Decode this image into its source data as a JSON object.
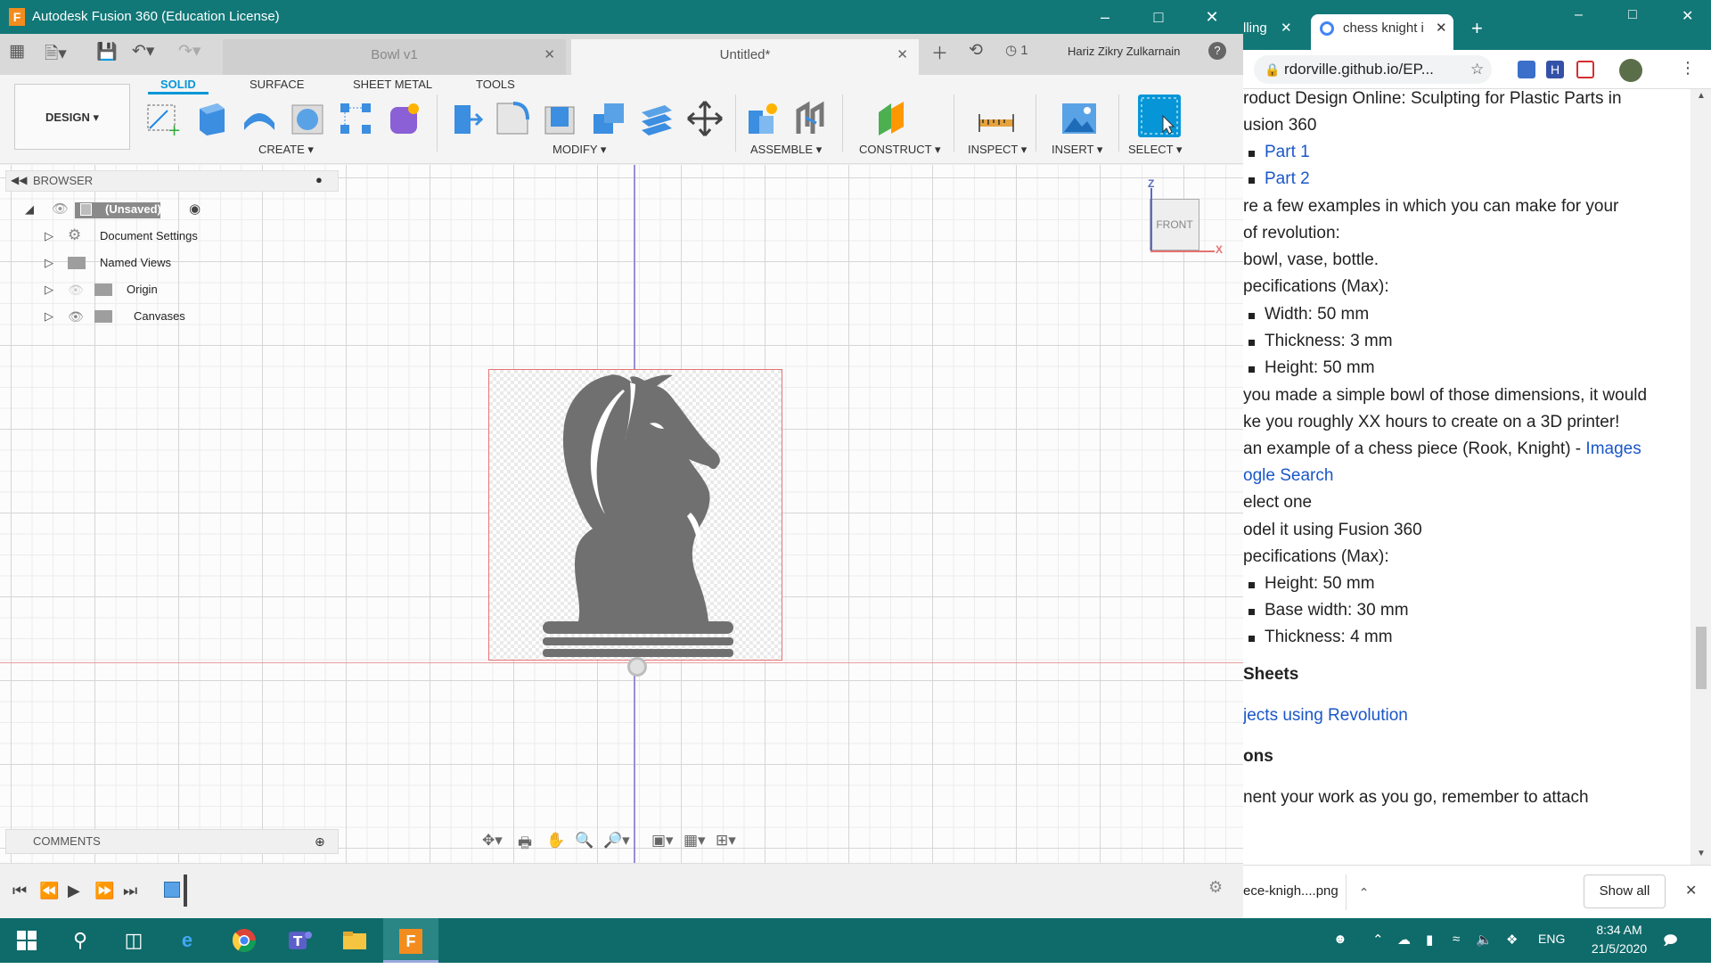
{
  "fusion": {
    "title": "Autodesk Fusion 360 (Education License)",
    "app_icon_letter": "F",
    "tabs": [
      {
        "label": "Bowl v1"
      },
      {
        "label": "Untitled*"
      }
    ],
    "job_count": "1",
    "user_name": "Hariz Zikry Zulkarnain",
    "help_label": "?",
    "ribbon_tabs": [
      "SOLID",
      "SURFACE",
      "SHEET METAL",
      "TOOLS"
    ],
    "workspace_label": "DESIGN ▾",
    "groups": [
      "CREATE ▾",
      "MODIFY ▾",
      "ASSEMBLE ▾",
      "CONSTRUCT ▾",
      "INSPECT ▾",
      "INSERT ▾",
      "SELECT ▾"
    ],
    "browser": {
      "header": "BROWSER",
      "root_label": "(Unsaved)",
      "items": [
        "Document Settings",
        "Named Views",
        "Origin",
        "Canvases"
      ]
    },
    "viewcube": {
      "face": "FRONT",
      "z_axis": "Z",
      "x_axis": "X"
    },
    "comments_label": "COMMENTS",
    "canvas_image": "chess-knight-silhouette"
  },
  "chrome": {
    "tabs": [
      {
        "label": "lling"
      },
      {
        "label": "chess knight i"
      }
    ],
    "new_tab": "+",
    "url": "rdorville.github.io/EP...",
    "content": {
      "lines": [
        {
          "text": "roduct Design Online: Sculpting for Plastic Parts in",
          "kind": "text"
        },
        {
          "text": "usion 360",
          "kind": "text"
        },
        {
          "text": "Part 1",
          "kind": "link-bullet"
        },
        {
          "text": "Part 2",
          "kind": "link-bullet"
        },
        {
          "text": "re a few examples in which you can make for your",
          "kind": "text"
        },
        {
          "text": " of revolution:",
          "kind": "text"
        },
        {
          "text": "bowl, vase, bottle.",
          "kind": "text"
        },
        {
          "text": "pecifications (Max):",
          "kind": "text"
        },
        {
          "text": "Width: 50 mm",
          "kind": "bullet"
        },
        {
          "text": "Thickness: 3 mm",
          "kind": "bullet"
        },
        {
          "text": "Height: 50 mm",
          "kind": "bullet"
        },
        {
          "text": "you made a simple bowl of those dimensions, it would",
          "kind": "text"
        },
        {
          "text": "ke you roughly XX hours to create on a 3D printer!",
          "kind": "text"
        },
        {
          "text": "an example of a chess piece (Rook, Knight) - ",
          "link": "Images",
          "kind": "mixed"
        },
        {
          "text": "ogle Search",
          "kind": "link"
        },
        {
          "text": "elect one",
          "kind": "text"
        },
        {
          "text": "odel it using Fusion 360",
          "kind": "text"
        },
        {
          "text": "pecifications (Max):",
          "kind": "text"
        },
        {
          "text": "Height: 50 mm",
          "kind": "bullet"
        },
        {
          "text": "Base width: 30 mm",
          "kind": "bullet"
        },
        {
          "text": "Thickness: 4 mm",
          "kind": "bullet"
        },
        {
          "text": " Sheets",
          "kind": "heading"
        },
        {
          "text": "jects using Revolution",
          "kind": "link"
        },
        {
          "text": "ons",
          "kind": "heading"
        },
        {
          "text": "nent your work as you go, remember to attach",
          "kind": "text"
        }
      ]
    },
    "download": {
      "file": "ece-knigh....png",
      "show_all": "Show all"
    }
  },
  "taskbar": {
    "lang": "ENG",
    "time": "8:34 AM",
    "date": "21/5/2020"
  }
}
